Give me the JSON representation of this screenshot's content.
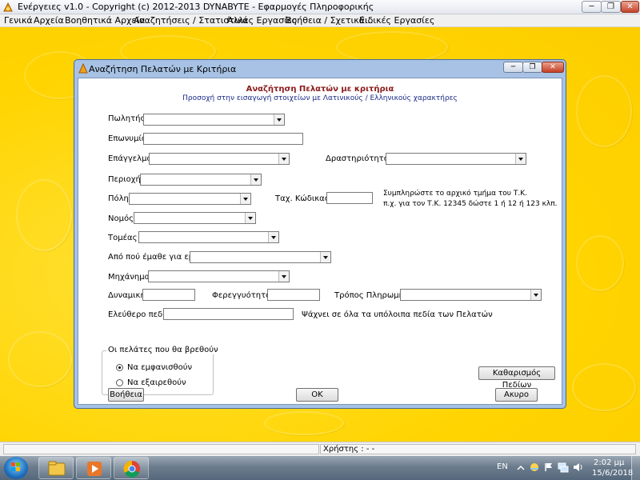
{
  "app": {
    "title": "Ενέργειες  v1.0  -  Copyright (c)  2012-2013  DYNABYTE - Εφαρμογές Πληροφορικής",
    "window_buttons": {
      "minimize": "─",
      "maximize": "❐",
      "close": "✕"
    }
  },
  "menubar": {
    "items": [
      {
        "label": "Γενικά"
      },
      {
        "label": "Αρχεία"
      },
      {
        "label": "Βοηθητικά Αρχεία"
      },
      {
        "label": "Αναζητήσεις / Στατιστικά"
      },
      {
        "label": "Άλλες Εργασίες"
      },
      {
        "label": "Βοήθεια / Σχετικά..."
      },
      {
        "label": "Ειδικές Εργασίες"
      }
    ]
  },
  "dialog": {
    "window_title": "Αναζήτηση Πελατών με Κριτήρια",
    "heading": "Αναζήτηση Πελατών με κριτήρια",
    "subheading": "Προσοχή στην εισαγωγή στοιχείων με Λατινικούς / Ελληνικούς χαρακτήρες",
    "fields": {
      "salesperson": "Πωλητής :",
      "name": "Επωνυμία :",
      "profession": "Επάγγελμα :",
      "activity": "Δραστηριότητα :",
      "area": "Περιοχή :",
      "city": "Πόλη :",
      "postal_code": "Ταχ. Κώδικας :",
      "postal_hint_1": "Συμπληρώστε το αρχικό τμήμα του Τ.Κ.",
      "postal_hint_2": "π.χ. για τον Τ.Κ. 12345 δώστε 1 ή 12 ή 123 κλπ.",
      "prefecture": "Νομός :",
      "sector": "Τομέας :",
      "source": "Από πού έμαθε για εμάς :",
      "machine": "Μηχάνημα :",
      "capacity": "Δυναμική :",
      "luminosity": "Φερεγγυότητα :",
      "payment_method": "Τρόπος Πληρωμής :",
      "free_field": "Ελεύθερο πεδίο :",
      "free_field_hint": "Ψάχνει σε όλα τα υπόλοιπα πεδία των Πελατών"
    },
    "group": {
      "title": "Οι πελάτες που θα βρεθούν",
      "options": [
        {
          "label": "Να εμφανισθούν",
          "selected": true
        },
        {
          "label": "Να εξαιρεθούν",
          "selected": false
        }
      ]
    },
    "buttons": {
      "clear": "Καθαρισμός Πεδίων",
      "help": "Βοήθεια",
      "ok": "OK",
      "cancel": "Ακυρο"
    }
  },
  "statusbar": {
    "user": "Χρήστης :  -  -"
  },
  "taskbar": {
    "language": "EN",
    "time": "2:02 μμ",
    "date": "15/6/2018"
  }
}
